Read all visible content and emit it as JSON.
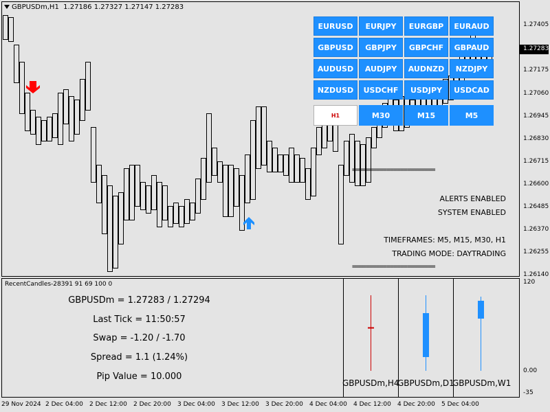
{
  "header": {
    "symbol": "GBPUSDm,H1",
    "ohlc": "1.27186 1.27327 1.27147 1.27283"
  },
  "price_axis": {
    "labels": [
      "1.27405",
      "1.27283",
      "1.27175",
      "1.27060",
      "1.26945",
      "1.26830",
      "1.26715",
      "1.26600",
      "1.26485",
      "1.26370",
      "1.26255",
      "1.26140"
    ],
    "current": "1.27283"
  },
  "symbol_buttons": [
    [
      "EURUSD",
      "EURJPY",
      "EURGBP",
      "EURAUD"
    ],
    [
      "GBPUSD",
      "GBPJPY",
      "GBPCHF",
      "GBPAUD"
    ],
    [
      "AUDUSD",
      "AUDJPY",
      "AUDNZD",
      "NZDJPY"
    ],
    [
      "NZDUSD",
      "USDCHF",
      "USDJPY",
      "USDCAD"
    ]
  ],
  "timeframe_buttons": [
    {
      "label": "H1",
      "active": true
    },
    {
      "label": "M30",
      "active": false
    },
    {
      "label": "M15",
      "active": false
    },
    {
      "label": "M5",
      "active": false
    }
  ],
  "status": {
    "separator_top": "========================",
    "alerts": "ALERTS ENABLED",
    "system": "SYSTEM ENABLED",
    "timeframes": "TIMEFRAMES: M5, M15, M30, H1",
    "trading_mode": "TRADING MODE: DAYTRADING",
    "separator_bottom": "========================"
  },
  "subwindow": {
    "title": "RecentCandles-28391 91 69 100 0",
    "lines": [
      "GBPUSDm = 1.27283 / 1.27294",
      "Last Tick = 11:50:57",
      "Swap = -1.20 / -1.70",
      "Spread = 1.1  (1.24%)",
      "Pip Value = 10.000"
    ],
    "candle_labels": [
      "GBPUSDm,H4",
      "GBPUSDm,D1",
      "GBPUSDm,W1"
    ],
    "axis_labels": [
      "120",
      "0.00",
      "-35"
    ]
  },
  "time_axis": [
    "29 Nov 2024",
    "2 Dec 04:00",
    "2 Dec 12:00",
    "2 Dec 20:00",
    "3 Dec 04:00",
    "3 Dec 12:00",
    "3 Dec 20:00",
    "4 Dec 04:00",
    "4 Dec 12:00",
    "4 Dec 20:00",
    "5 Dec 04:00"
  ],
  "colors": {
    "button": "#1e90ff",
    "sell_arrow": "#ff0000",
    "buy_arrow": "#1e90ff",
    "h4_candle": "#cc0000",
    "up_candle": "#1e90ff"
  }
}
